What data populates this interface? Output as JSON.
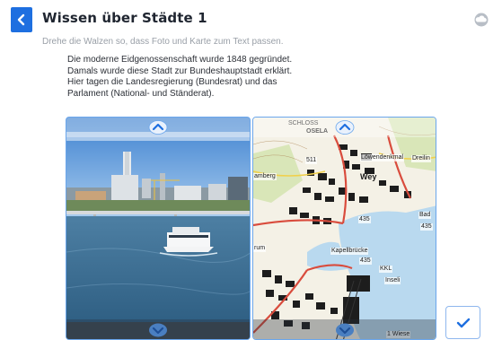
{
  "header": {
    "title": "Wissen über Städte 1",
    "back_icon": "chevron-left-icon",
    "cloud_icon": "cloud-icon"
  },
  "instruction": "Drehe die Walzen so, dass Foto und Karte zum Text passen.",
  "task_text": [
    "Die moderne Eidgenossenschaft wurde 1848 gegründet.",
    "Damals wurde diese Stadt zur Bundeshauptstadt erklärt.",
    "Hier tagen die Landesregierung (Bundesrat) und das",
    "Parlament (National- und Ständerat)."
  ],
  "map_labels": {
    "top_a": "SCHLOSS",
    "top_b": "OSELA",
    "l1": "511",
    "l2": "Löwendenkmal",
    "l3": "Dreilin",
    "l4": "amberg",
    "l5": "Wey",
    "l6": "435",
    "l7": "Bad",
    "l8": "435",
    "l9": "Kapellbrücke",
    "l10": "435",
    "l11": "KKL",
    "l12": "Inseli",
    "l13": "rum",
    "l14": "1 Wiese"
  },
  "colors": {
    "accent": "#1e6fe0",
    "reel_border": "#6aa6ec",
    "water": "#b9d9ef"
  }
}
